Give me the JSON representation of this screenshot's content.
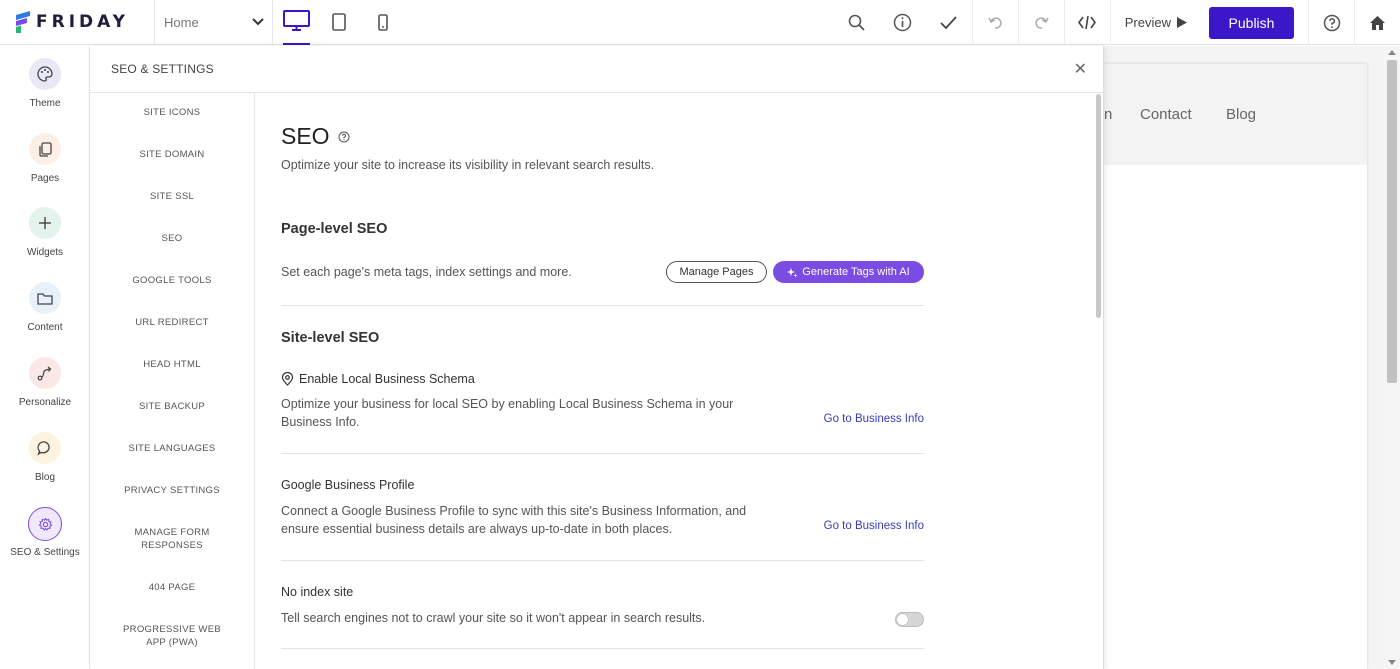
{
  "app": {
    "logo_text": "FRIDAY"
  },
  "toolbar": {
    "page_select_value": "Home",
    "preview_label": "Preview",
    "publish_label": "Publish",
    "icons": [
      "search-icon",
      "info-icon",
      "check-icon",
      "undo-icon",
      "redo-icon",
      "code-icon",
      "help-icon",
      "home-icon"
    ]
  },
  "rail": {
    "items": [
      {
        "label": "Theme",
        "icon": "palette-icon",
        "color": "#e8e8f6"
      },
      {
        "label": "Pages",
        "icon": "pages-icon",
        "color": "#fcefe6"
      },
      {
        "label": "Widgets",
        "icon": "plus-icon",
        "color": "#e4f3ec"
      },
      {
        "label": "Content",
        "icon": "folder-icon",
        "color": "#e6f1f9"
      },
      {
        "label": "Personalize",
        "icon": "route-icon",
        "color": "#fbe8e6"
      },
      {
        "label": "Blog",
        "icon": "chat-icon",
        "color": "#fcf3e0"
      },
      {
        "label": "SEO & Settings",
        "icon": "gear-icon",
        "color": "#f1e8fb"
      }
    ]
  },
  "panel": {
    "title": "SEO & SETTINGS",
    "subnav": [
      "SITE ICONS",
      "SITE DOMAIN",
      "SITE SSL",
      "SEO",
      "GOOGLE TOOLS",
      "URL REDIRECT",
      "HEAD HTML",
      "SITE BACKUP",
      "SITE LANGUAGES",
      "PRIVACY SETTINGS",
      "MANAGE FORM RESPONSES",
      "404 PAGE",
      "PROGRESSIVE WEB APP (PWA)"
    ]
  },
  "seo": {
    "title": "SEO",
    "intro": "Optimize your site to increase its visibility in relevant search results.",
    "page_level": {
      "title": "Page-level SEO",
      "text": "Set each page's meta tags, index settings and more.",
      "manage_pages_label": "Manage Pages",
      "generate_tags_label": "Generate Tags with AI"
    },
    "site_level": {
      "title": "Site-level SEO",
      "local_schema_title": "Enable Local Business Schema",
      "local_schema_text_1": "Optimize your business for local SEO by enabling Local Business Schema in your",
      "local_schema_text_2": "Business Info.",
      "local_schema_link": "Go to Business Info",
      "gbp_title": "Google Business Profile",
      "gbp_text_1": "Connect a Google Business Profile to sync with this site's Business Information, and",
      "gbp_text_2": "ensure essential business details are always up-to-date in both places.",
      "gbp_link": "Go to Business Info",
      "noindex_title": "No index site",
      "noindex_text": "Tell search engines not to crawl your site so it won't appear in search results.",
      "noindex_enabled": false
    }
  },
  "site_preview": {
    "nav_fragment": "n",
    "nav_items": [
      "Contact",
      "Blog"
    ]
  }
}
